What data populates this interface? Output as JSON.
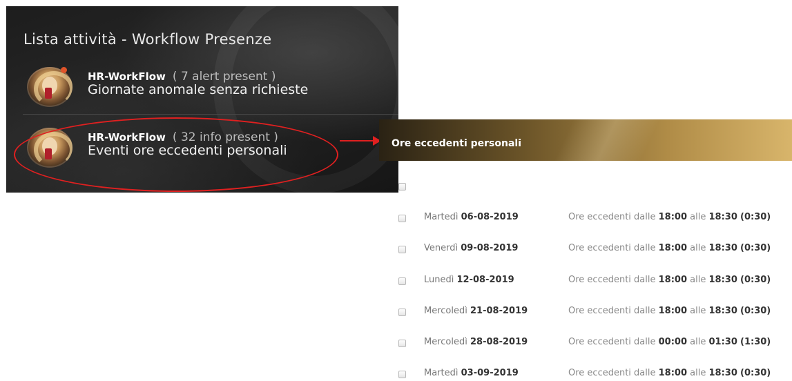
{
  "panel": {
    "title": "Lista attività - Workflow Presenze",
    "items": [
      {
        "source": "HR-WorkFlow",
        "count": "( 7 alert present )",
        "description": "Giornate anomale senza richieste"
      },
      {
        "source": "HR-WorkFlow",
        "count": "( 32 info present )",
        "description": "Eventi ore eccedenti personali"
      }
    ]
  },
  "detail": {
    "title": "Ore eccedenti personali",
    "rows": [
      {
        "day": "Martedì",
        "date": "06-08-2019",
        "prefix": "Ore eccedenti dalle",
        "from": "18:00",
        "to_word": "alle",
        "to": "18:30",
        "duration": "(0:30)"
      },
      {
        "day": "Venerdì",
        "date": "09-08-2019",
        "prefix": "Ore eccedenti dalle",
        "from": "18:00",
        "to_word": "alle",
        "to": "18:30",
        "duration": "(0:30)"
      },
      {
        "day": "Lunedì",
        "date": "12-08-2019",
        "prefix": "Ore eccedenti dalle",
        "from": "18:00",
        "to_word": "alle",
        "to": "18:30",
        "duration": "(0:30)"
      },
      {
        "day": "Mercoledì",
        "date": "21-08-2019",
        "prefix": "Ore eccedenti dalle",
        "from": "18:00",
        "to_word": "alle",
        "to": "18:30",
        "duration": "(0:30)"
      },
      {
        "day": "Mercoledì",
        "date": "28-08-2019",
        "prefix": "Ore eccedenti dalle",
        "from": "00:00",
        "to_word": "alle",
        "to": "01:30",
        "duration": "(1:30)"
      },
      {
        "day": "Martedì",
        "date": "03-09-2019",
        "prefix": "Ore eccedenti dalle",
        "from": "18:00",
        "to_word": "alle",
        "to": "18:30",
        "duration": "(0:30)"
      }
    ]
  },
  "colors": {
    "highlight": "#e02020",
    "notification": "#e0542a",
    "header_gold": "#b08c47"
  }
}
